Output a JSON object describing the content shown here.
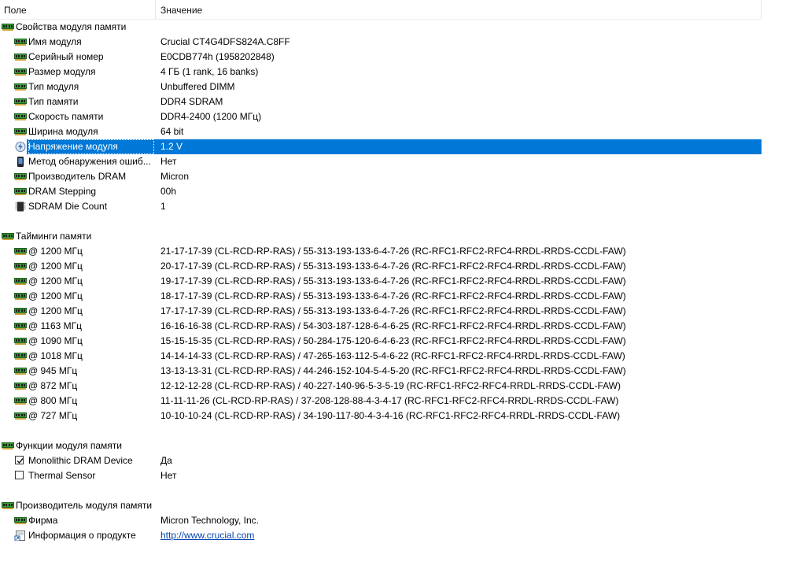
{
  "columns": {
    "field": "Поле",
    "value": "Значение"
  },
  "module_props": {
    "title": "Свойства модуля памяти",
    "items": [
      {
        "field": "Имя модуля",
        "value": "Crucial CT4G4DFS824A.C8FF",
        "icon": "memory-module-icon"
      },
      {
        "field": "Серийный номер",
        "value": "E0CDB774h (1958202848)",
        "icon": "memory-module-icon"
      },
      {
        "field": "Размер модуля",
        "value": "4 ГБ (1 rank, 16 banks)",
        "icon": "memory-module-icon"
      },
      {
        "field": "Тип модуля",
        "value": "Unbuffered DIMM",
        "icon": "memory-module-icon"
      },
      {
        "field": "Тип памяти",
        "value": "DDR4 SDRAM",
        "icon": "memory-module-icon"
      },
      {
        "field": "Скорость памяти",
        "value": "DDR4-2400 (1200 МГц)",
        "icon": "memory-module-icon"
      },
      {
        "field": "Ширина модуля",
        "value": "64 bit",
        "icon": "memory-module-icon"
      },
      {
        "field": "Напряжение модуля",
        "value": "1.2 V",
        "icon": "voltage-icon",
        "selected": true
      },
      {
        "field": "Метод обнаружения ошиб...",
        "value": "Нет",
        "icon": "phone-icon"
      },
      {
        "field": "Производитель DRAM",
        "value": "Micron",
        "icon": "memory-module-icon"
      },
      {
        "field": "DRAM Stepping",
        "value": "00h",
        "icon": "memory-module-icon"
      },
      {
        "field": "SDRAM Die Count",
        "value": "1",
        "icon": "chip-icon"
      }
    ]
  },
  "timings": {
    "title": "Тайминги памяти",
    "items": [
      {
        "field": "@ 1200 МГц",
        "value": "21-17-17-39  (CL-RCD-RP-RAS) / 55-313-193-133-6-4-7-26  (RC-RFC1-RFC2-RFC4-RRDL-RRDS-CCDL-FAW)"
      },
      {
        "field": "@ 1200 МГц",
        "value": "20-17-17-39  (CL-RCD-RP-RAS) / 55-313-193-133-6-4-7-26  (RC-RFC1-RFC2-RFC4-RRDL-RRDS-CCDL-FAW)"
      },
      {
        "field": "@ 1200 МГц",
        "value": "19-17-17-39  (CL-RCD-RP-RAS) / 55-313-193-133-6-4-7-26  (RC-RFC1-RFC2-RFC4-RRDL-RRDS-CCDL-FAW)"
      },
      {
        "field": "@ 1200 МГц",
        "value": "18-17-17-39  (CL-RCD-RP-RAS) / 55-313-193-133-6-4-7-26  (RC-RFC1-RFC2-RFC4-RRDL-RRDS-CCDL-FAW)"
      },
      {
        "field": "@ 1200 МГц",
        "value": "17-17-17-39  (CL-RCD-RP-RAS) / 55-313-193-133-6-4-7-26  (RC-RFC1-RFC2-RFC4-RRDL-RRDS-CCDL-FAW)"
      },
      {
        "field": "@ 1163 МГц",
        "value": "16-16-16-38  (CL-RCD-RP-RAS) / 54-303-187-128-6-4-6-25  (RC-RFC1-RFC2-RFC4-RRDL-RRDS-CCDL-FAW)"
      },
      {
        "field": "@ 1090 МГц",
        "value": "15-15-15-35  (CL-RCD-RP-RAS) / 50-284-175-120-6-4-6-23  (RC-RFC1-RFC2-RFC4-RRDL-RRDS-CCDL-FAW)"
      },
      {
        "field": "@ 1018 МГц",
        "value": "14-14-14-33  (CL-RCD-RP-RAS) / 47-265-163-112-5-4-6-22  (RC-RFC1-RFC2-RFC4-RRDL-RRDS-CCDL-FAW)"
      },
      {
        "field": "@ 945 МГц",
        "value": "13-13-13-31  (CL-RCD-RP-RAS) / 44-246-152-104-5-4-5-20  (RC-RFC1-RFC2-RFC4-RRDL-RRDS-CCDL-FAW)"
      },
      {
        "field": "@ 872 МГц",
        "value": "12-12-12-28  (CL-RCD-RP-RAS) / 40-227-140-96-5-3-5-19  (RC-RFC1-RFC2-RFC4-RRDL-RRDS-CCDL-FAW)"
      },
      {
        "field": "@ 800 МГц",
        "value": "11-11-11-26  (CL-RCD-RP-RAS) / 37-208-128-88-4-3-4-17  (RC-RFC1-RFC2-RFC4-RRDL-RRDS-CCDL-FAW)"
      },
      {
        "field": "@ 727 МГц",
        "value": "10-10-10-24  (CL-RCD-RP-RAS) / 34-190-117-80-4-3-4-16  (RC-RFC1-RFC2-RFC4-RRDL-RRDS-CCDL-FAW)"
      }
    ]
  },
  "features": {
    "title": "Функции модуля памяти",
    "items": [
      {
        "field": "Monolithic DRAM Device",
        "value": "Да",
        "checked": true
      },
      {
        "field": "Thermal Sensor",
        "value": "Нет",
        "checked": false
      }
    ]
  },
  "manufacturer": {
    "title": "Производитель модуля памяти",
    "items": [
      {
        "field": "Фирма",
        "value": "Micron Technology, Inc.",
        "icon": "memory-module-icon"
      },
      {
        "field": "Информация о продукте",
        "value": "http://www.crucial.com",
        "icon": "web-link-icon",
        "link": true
      }
    ]
  },
  "colors": {
    "selection": "#0078d7",
    "ram_green": "#2e8b2e",
    "link": "#0645ad"
  }
}
